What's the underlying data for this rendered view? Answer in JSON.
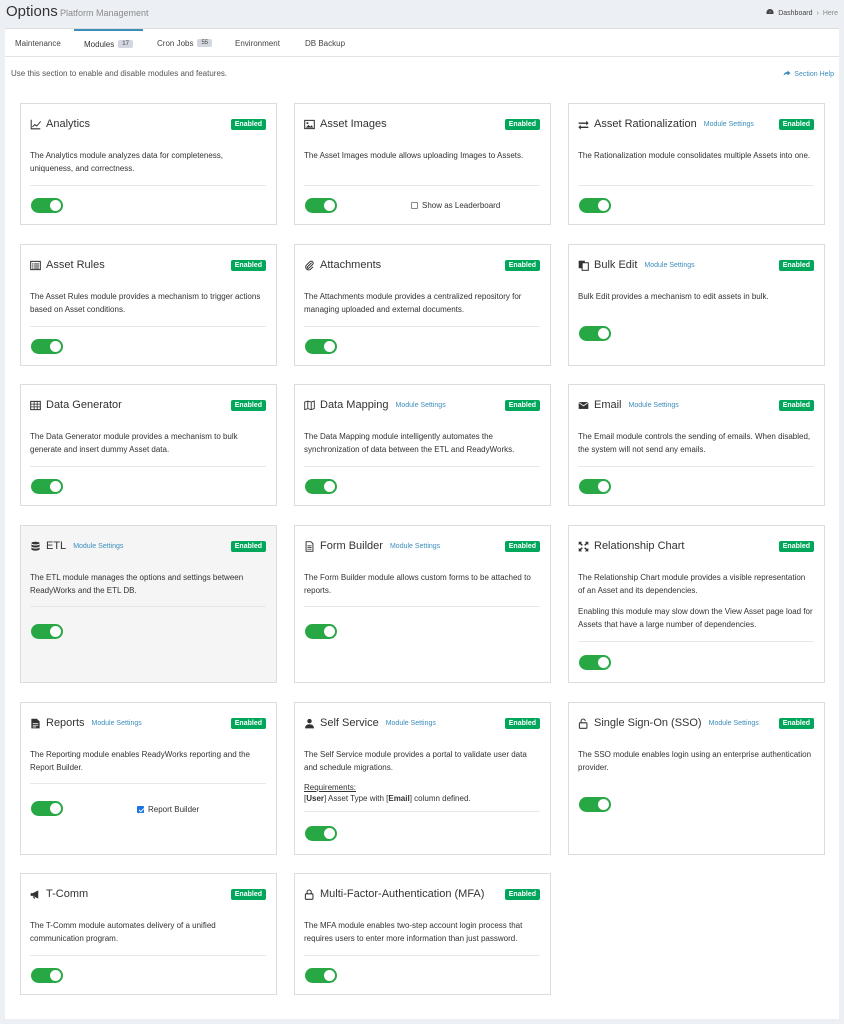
{
  "header": {
    "title": "Options",
    "subtitle": "Platform Management"
  },
  "breadcrumb": {
    "home": "Dashboard",
    "separator": "›",
    "current": "Here"
  },
  "tabs": [
    {
      "label": "Maintenance"
    },
    {
      "label": "Modules",
      "count": "17"
    },
    {
      "label": "Cron Jobs",
      "count": "55"
    },
    {
      "label": "Environment"
    },
    {
      "label": "DB Backup"
    }
  ],
  "intro": "Use this section to enable and disable modules and features.",
  "section_help": "Section Help",
  "enabled_label": "Enabled",
  "module_settings_label": "Module Settings",
  "modules": [
    {
      "title": "Analytics",
      "icon": "chart-line-icon",
      "desc": "The Analytics module analyzes data for completeness, uniqueness, and correctness."
    },
    {
      "title": "Asset Images",
      "icon": "image-icon",
      "desc": "The Asset Images module allows uploading Images to Assets.",
      "checkbox": "Show as Leaderboard"
    },
    {
      "title": "Asset Rationalization",
      "icon": "exchange-icon",
      "settings": true,
      "desc": "The Rationalization module consolidates multiple Assets into one."
    },
    {
      "title": "Asset Rules",
      "icon": "list-alt-icon",
      "desc": "The Asset Rules module provides a mechanism to trigger actions based on Asset conditions."
    },
    {
      "title": "Attachments",
      "icon": "paperclip-icon",
      "desc": "The Attachments module provides a centralized repository for managing uploaded and external documents."
    },
    {
      "title": "Bulk Edit",
      "icon": "copy-icon",
      "settings": true,
      "desc": "Bulk Edit provides a mechanism to edit assets in bulk."
    },
    {
      "title": "Data Generator",
      "icon": "table-icon",
      "desc": "The Data Generator module provides a mechanism to bulk generate and insert dummy Asset data."
    },
    {
      "title": "Data Mapping",
      "icon": "map-icon",
      "settings": true,
      "desc": "The Data Mapping module intelligently automates the synchronization of data between the ETL and ReadyWorks."
    },
    {
      "title": "Email",
      "icon": "envelope-icon",
      "settings": true,
      "desc": "The Email module controls the sending of emails. When disabled, the system will not send any emails."
    },
    {
      "title": "ETL",
      "icon": "database-icon",
      "settings": true,
      "desc": "The ETL module manages the options and settings between ReadyWorks and the ETL DB."
    },
    {
      "title": "Form Builder",
      "icon": "file-text-icon",
      "settings": true,
      "desc": "The Form Builder module allows custom forms to be attached to reports."
    },
    {
      "title": "Relationship Chart",
      "icon": "expand-icon",
      "desc": "The Relationship Chart module provides a visible representation of an Asset and its dependencies.",
      "desc2": "Enabling this module may slow down the View Asset page load for Assets that have a large number of dependencies."
    },
    {
      "title": "Reports",
      "icon": "file-icon",
      "settings": true,
      "desc": "The Reporting module enables ReadyWorks reporting and the Report Builder.",
      "checkbox": "Report Builder"
    },
    {
      "title": "Self Service",
      "icon": "user-icon",
      "settings": true,
      "desc": "The Self Service module provides a portal to validate user data and schedule migrations.",
      "req_title": "Requirements:",
      "req": [
        "[",
        "User",
        "] Asset Type with [",
        "Email",
        "] column defined."
      ]
    },
    {
      "title": "Single Sign-On (SSO)",
      "icon": "unlock-icon",
      "settings": true,
      "desc": "The SSO module enables login using an enterprise authentication provider."
    },
    {
      "title": "T-Comm",
      "icon": "bullhorn-icon",
      "desc": "The T-Comm module automates delivery of a unified communication program."
    },
    {
      "title": "Multi-Factor-Authentication (MFA)",
      "icon": "lock-icon",
      "desc": "The MFA module enables two-step account login process that requires users to enter more information than just password."
    }
  ]
}
